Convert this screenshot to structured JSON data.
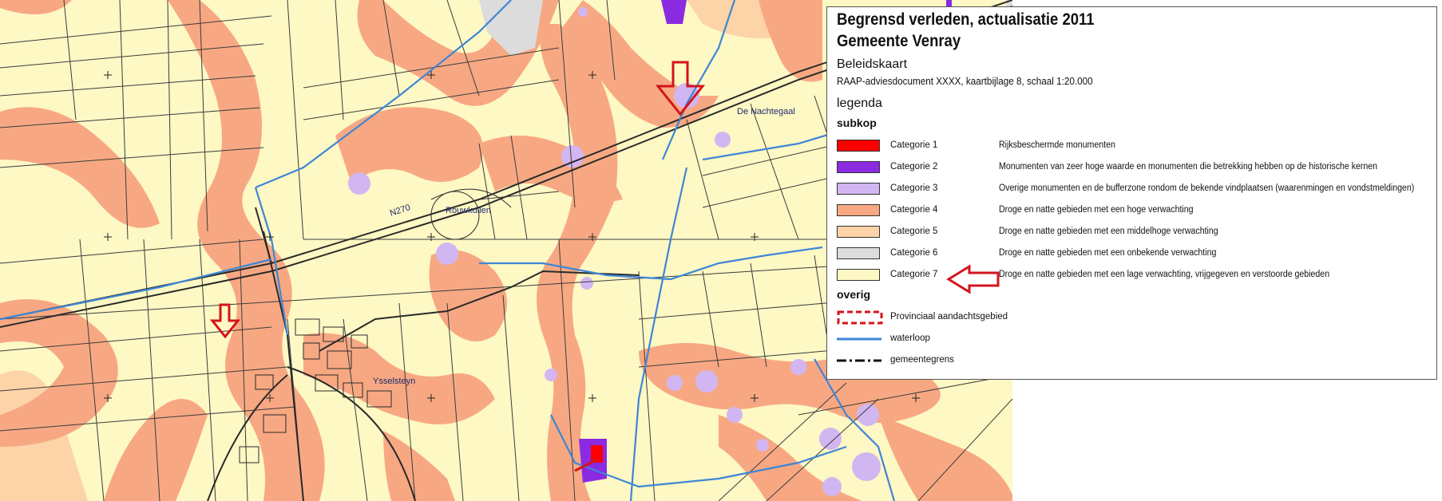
{
  "colors": {
    "background_yellow": "#fdf8c4",
    "high_expectation": "#f7a882",
    "medium_expectation": "#fdd3a8",
    "unknown": "#dcdcdc",
    "monument_rijks": "#ff0000",
    "monument_high": "#8a2be2",
    "monument_other": "#d2b6f2",
    "waterway": "#3e86d6",
    "arrow": "#d4141c"
  },
  "map": {
    "places": {
      "nachtegaal": "De Nachtegaal",
      "n270": "N270",
      "rouwkuilen": "Rouwkuilen",
      "ysselsteyn": "Ysselsteyn"
    }
  },
  "legend": {
    "title_line1": "Begrensd verleden, actualisatie 2011",
    "title_line2": "Gemeente Venray",
    "subtitle": "Beleidskaart",
    "document": "RAAP-adviesdocument XXXX, kaartbijlage 8, schaal 1:20.000",
    "legend_heading": "legenda",
    "subkop_heading": "subkop",
    "categories": [
      {
        "label": "Categorie 1",
        "description": "Rijksbeschermde monumenten",
        "color": "#ff0000"
      },
      {
        "label": "Categorie 2",
        "description": "Monumenten van zeer hoge waarde en monumenten die betrekking hebben op de historische kernen",
        "color": "#8a2be2"
      },
      {
        "label": "Categorie 3",
        "description": "Overige monumenten en de bufferzone rondom de bekende vindplaatsen (waarenmingen en vondstmeldingen)",
        "color": "#d2b6f2"
      },
      {
        "label": "Categorie 4",
        "description": "Droge en natte gebieden met een hoge verwachting",
        "color": "#f7a882"
      },
      {
        "label": "Categorie 5",
        "description": "Droge en natte gebieden met een middelhoge verwachting",
        "color": "#fdd3a8"
      },
      {
        "label": "Categorie 6",
        "description": "Droge en natte gebieden met een onbekende verwachting",
        "color": "#dcdcdc"
      },
      {
        "label": "Categorie 7",
        "description": "Droge en natte gebieden met een lage verwachting, vrijgegeven en verstoorde gebieden",
        "color": "#fdf8c4"
      }
    ],
    "overig_heading": "overig",
    "overig": [
      {
        "label": "Provinciaal aandachtsgebied",
        "icon": "dashed-red-box-icon"
      },
      {
        "label": "waterloop",
        "icon": "blue-line-icon"
      },
      {
        "label": "gemeentegrens",
        "icon": "dash-dot-line-icon"
      }
    ]
  }
}
